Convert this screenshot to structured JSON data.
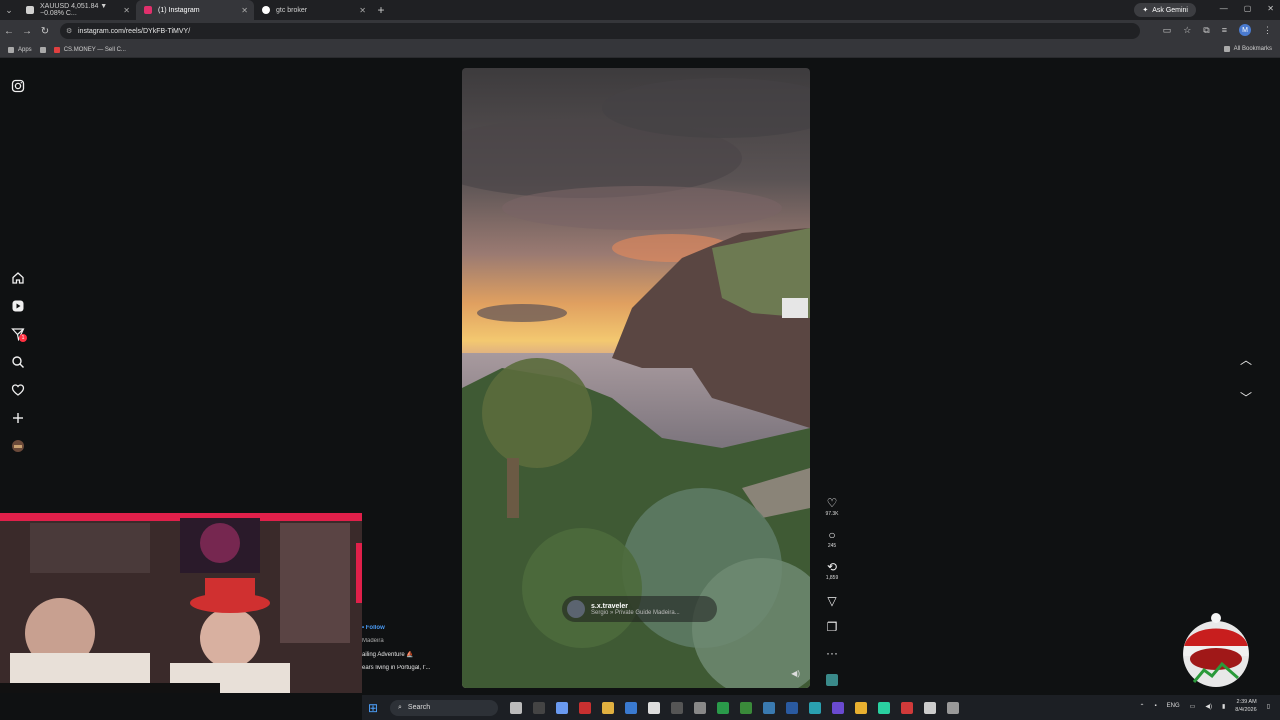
{
  "browser": {
    "tabs": [
      {
        "label": "XAUUSD 4,051.84 ▼ −0.08% C..."
      },
      {
        "label": "(1) Instagram"
      },
      {
        "label": "gtc broker"
      }
    ],
    "ask_gemini": "Ask Gemini",
    "url": "instagram.com/reels/DYkFB-TiMVY/",
    "profile_initial": "M",
    "bookmarks": {
      "apps": "Apps",
      "csmoney": "CS.MONEY — Sell C...",
      "all": "All Bookmarks"
    }
  },
  "sidebar": {
    "notification_count": "1"
  },
  "reel": {
    "author_name": "s.x.traveler",
    "author_subtitle": "Sergio » Private Guide Madeira...",
    "likes": "97.3K",
    "comments": "245",
    "reposts": "1,859"
  },
  "caption": {
    "follow": "• Follow",
    "location": "Madeira",
    "line1": "ailing Adventure ⛵",
    "line2": "ears living in Portugal, I'..."
  },
  "taskbar": {
    "search": "Search",
    "lang": "ENG",
    "time": "2:39 AM",
    "date": "8/4/2026"
  },
  "colors": {
    "accent_blue": "#4a9bf5",
    "notification_red": "#ff3040",
    "page_bg": "#0f1112"
  }
}
